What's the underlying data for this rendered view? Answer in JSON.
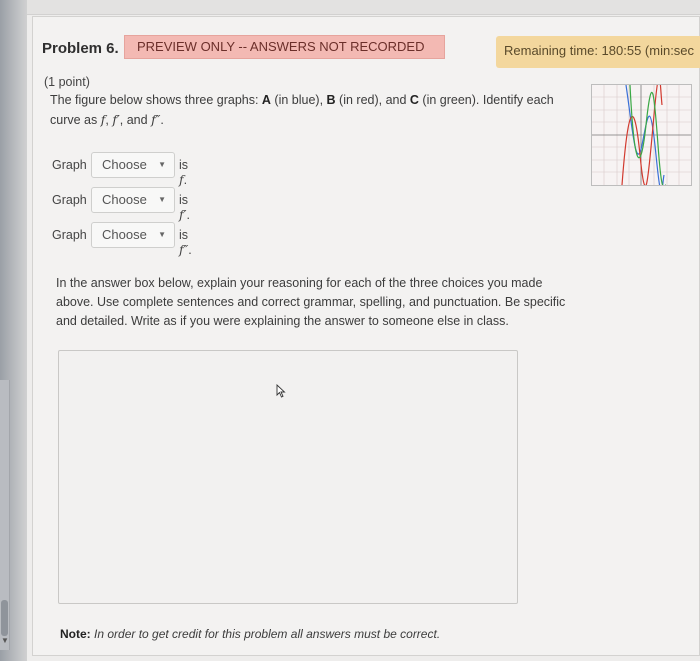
{
  "problem": {
    "title": "Problem 6.",
    "preview_badge": "PREVIEW ONLY -- ANSWERS NOT RECORDED",
    "timer": "Remaining time: 180:55 (min:sec",
    "points": "(1 point)",
    "intro_pre": "The figure below shows three graphs: ",
    "curve_a": "A",
    "curve_a_desc": " (in blue), ",
    "curve_b": "B",
    "curve_b_desc": " (in red), and ",
    "curve_c": "C",
    "curve_c_desc": " (in green). Identify each curve as ",
    "f": "f",
    "f_prime": "f′",
    "and": ", and ",
    "f_double_prime": "f″",
    "sep": ", ",
    "period": "."
  },
  "selects": [
    {
      "label": "Graph",
      "value": "Choose",
      "tail_text": "is ",
      "func": "f",
      "end": "."
    },
    {
      "label": "Graph",
      "value": "Choose",
      "tail_text": "is ",
      "func": "f′",
      "end": "."
    },
    {
      "label": "Graph",
      "value": "Choose",
      "tail_text": "is ",
      "func": "f″",
      "end": "."
    }
  ],
  "instructions": "In the answer box below, explain your reasoning for each of the three choices you made above. Use complete sentences and correct grammar, spelling, and punctuation. Be specific and detailed. Write as if you were explaining the answer to someone else in class.",
  "answer_box": {
    "value": ""
  },
  "note": {
    "label": "Note:",
    "text": " In order to get credit for this problem all answers must be correct."
  },
  "colors": {
    "curve_a": "#3a6fd8",
    "curve_b": "#d23a2f",
    "curve_c": "#3aa845",
    "preview_bg": "#f3b9b3",
    "timer_bg": "#f3d79d"
  },
  "icons": [
    "dropdown-caret-icon",
    "mouse-pointer-icon"
  ]
}
